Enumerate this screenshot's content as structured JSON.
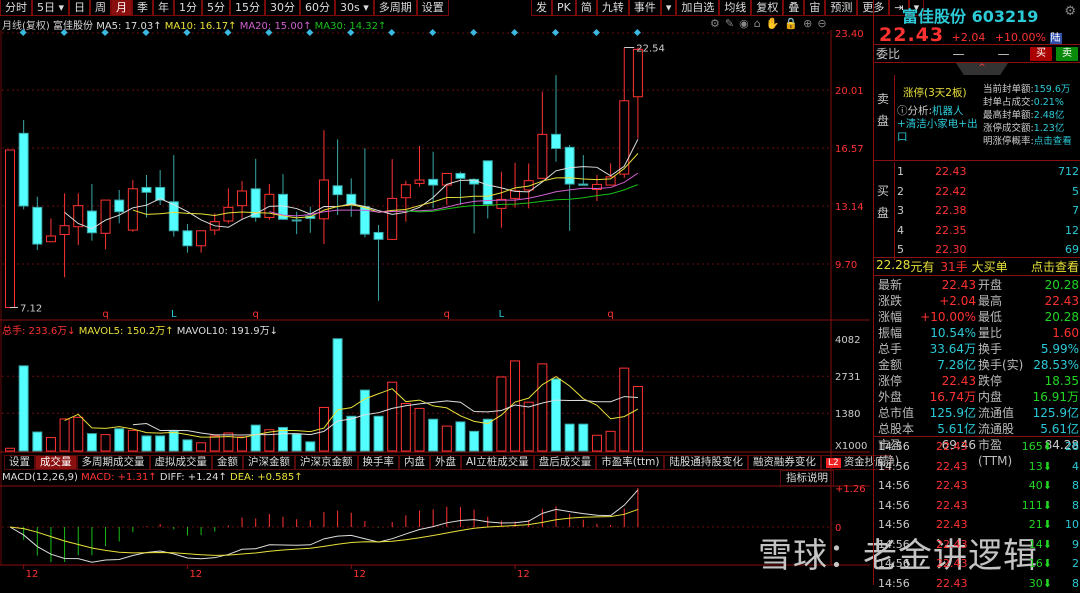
{
  "toolbar": {
    "left": [
      "分时",
      "5日 ▾",
      "日",
      "周",
      "月",
      "季",
      "年",
      "1分",
      "5分",
      "15分",
      "30分",
      "60分",
      "30s ▾",
      "多周期",
      "设置"
    ],
    "active": "月",
    "right": [
      "发",
      "PK",
      "简",
      "九转",
      "事件",
      "▾",
      "加自选",
      "均线",
      "复权",
      "叠",
      "宙",
      "预测",
      "更多",
      "⇥",
      "▾"
    ]
  },
  "info": {
    "period": "月线(复权)",
    "name": "富佳股份",
    "ma5": "MA5: 17.03↑",
    "ma10": "MA10: 16.17↑",
    "ma20": "MA20: 15.00↑",
    "ma30": "MA30: 14.32↑"
  },
  "tools": [
    "⚙",
    "✎",
    "◉",
    "⌂",
    "✋",
    "🔒",
    "⊕",
    "⊖"
  ],
  "price_axis": [
    "23.40",
    "20.01",
    "16.57",
    "13.14",
    "9.70"
  ],
  "price_levels": [
    23.4,
    20.01,
    16.57,
    13.14,
    9.7
  ],
  "high_label": "22.54",
  "low_label": "7.12",
  "markers": [
    {
      "i": 7,
      "t": "q",
      "c": "#ff3232"
    },
    {
      "i": 12,
      "t": "L",
      "c": "#2cc9d6"
    },
    {
      "i": 18,
      "t": "q",
      "c": "#ff3232"
    },
    {
      "i": 32,
      "t": "q",
      "c": "#ff3232"
    },
    {
      "i": 36,
      "t": "L",
      "c": "#2cc9d6"
    },
    {
      "i": 44,
      "t": "q",
      "c": "#ff3232"
    }
  ],
  "candles": [
    [
      7.12,
      16.46,
      16.46,
      7.12
    ],
    [
      17.45,
      13.14,
      18.24,
      12.94
    ],
    [
      13.06,
      10.88,
      13.69,
      10.53
    ],
    [
      11.02,
      11.36,
      12.4,
      11.02
    ],
    [
      11.45,
      11.97,
      13.89,
      8.91
    ],
    [
      11.91,
      13.16,
      13.89,
      10.82
    ],
    [
      12.84,
      11.55,
      14.44,
      11.08
    ],
    [
      11.52,
      13.49,
      13.49,
      10.57
    ],
    [
      13.49,
      12.8,
      14.09,
      12.11
    ],
    [
      11.71,
      14.16,
      14.68,
      11.61
    ],
    [
      14.24,
      13.95,
      14.98,
      12.46
    ],
    [
      14.24,
      13.49,
      15.27,
      13.2
    ],
    [
      13.39,
      11.67,
      16.16,
      11.32
    ],
    [
      11.67,
      10.78,
      12.07,
      10.37
    ],
    [
      10.78,
      11.67,
      11.67,
      10.37
    ],
    [
      11.71,
      12.21,
      12.7,
      11.42
    ],
    [
      12.25,
      13.06,
      14.18,
      12.11
    ],
    [
      13.16,
      14.03,
      14.62,
      12.4
    ],
    [
      14.16,
      12.46,
      15.94,
      12.21
    ],
    [
      12.46,
      13.83,
      14.44,
      12.31
    ],
    [
      13.83,
      12.35,
      15.03,
      12.31
    ],
    [
      12.31,
      12.27,
      12.8,
      11.47
    ],
    [
      12.54,
      12.4,
      13.1,
      11.55
    ],
    [
      12.38,
      14.68,
      17.64,
      10.88
    ],
    [
      14.34,
      13.81,
      17.09,
      12.6
    ],
    [
      13.83,
      13.2,
      14.78,
      12.5
    ],
    [
      13.1,
      11.47,
      16.56,
      11.28
    ],
    [
      11.57,
      11.16,
      12.01,
      7.52
    ],
    [
      11.16,
      13.59,
      15.92,
      11.12
    ],
    [
      13.63,
      14.4,
      14.64,
      12.21
    ],
    [
      14.48,
      14.68,
      16.7,
      14.28
    ],
    [
      14.72,
      14.38,
      16.36,
      13.0
    ],
    [
      14.38,
      15.07,
      15.07,
      13.2
    ],
    [
      15.07,
      14.78,
      15.17,
      13.2
    ],
    [
      14.72,
      14.44,
      14.78,
      11.51
    ],
    [
      15.82,
      13.24,
      15.82,
      12.4
    ],
    [
      13.0,
      13.53,
      15.17,
      11.85
    ],
    [
      13.59,
      14.03,
      15.7,
      13.04
    ],
    [
      14.09,
      14.64,
      15.66,
      13.0
    ],
    [
      14.78,
      17.39,
      19.92,
      14.78
    ],
    [
      17.39,
      16.55,
      20.9,
      15.76
    ],
    [
      16.62,
      14.44,
      16.76,
      11.67
    ],
    [
      14.44,
      14.37,
      16.16,
      14.37
    ],
    [
      14.12,
      14.42,
      14.97,
      13.43
    ],
    [
      14.38,
      14.87,
      15.67,
      14.38
    ],
    [
      15.03,
      19.38,
      22.54,
      14.81
    ],
    [
      19.62,
      22.43,
      22.54,
      17.15
    ]
  ],
  "volume": {
    "header": {
      "total": "总手: 233.6万↓",
      "mavol5": "MAVOL5: 150.2万↑",
      "mavol10": "MAVOL10: 191.9万↓"
    },
    "axis": [
      "4082",
      "2731",
      "1380",
      "X1000"
    ],
    "levels": [
      4082,
      2731,
      1380
    ],
    "values": [
      100,
      3110,
      694,
      490,
      1170,
      1230,
      634,
      598,
      813,
      753,
      550,
      550,
      730,
      407,
      300,
      550,
      658,
      514,
      945,
      777,
      861,
      622,
      335,
      1590,
      4100,
      1268,
      2224,
      1268,
      2512,
      1734,
      1555,
      1160,
      909,
      1064,
      718,
      1160,
      2703,
      3289,
      1782,
      3181,
      2631,
      981,
      981,
      574,
      718,
      3026,
      2356
    ]
  },
  "tabs": [
    "设置",
    "成交量",
    "多周期成交量",
    "虚拟成交量",
    "金额",
    "沪深金额",
    "沪深京金额",
    "换手率",
    "内盘",
    "外盘",
    "AI立桩成交量",
    "盘后成交量",
    "市盈率(ttm)",
    "陆股通持股变化",
    "融资融券变化",
    "资金抄底"
  ],
  "tab_active": "成交量",
  "tab_l2": "L2",
  "explain": "指标说明",
  "macd": {
    "label": "MACD(12,26,9)",
    "macd": "MACD: +1.31↑",
    "diff": "DIFF: +1.24↑",
    "dea": "DEA: +0.585↑",
    "axis_top": "+1.26",
    "axis_zero": "0"
  },
  "date_labels": [
    {
      "i": 1,
      "t": "12"
    },
    {
      "i": 13,
      "t": "12"
    },
    {
      "i": 25,
      "t": "12"
    },
    {
      "i": 37,
      "t": "12"
    }
  ],
  "watermark": "雪球：老金讲逻辑",
  "panel": {
    "title": "富佳股份 603219",
    "price": "22.43",
    "change": "+2.04",
    "pct": "+10.00%",
    "badge": "陆",
    "weibi": "委比",
    "weibi_v1": "—",
    "weibi_v2": "—",
    "buy": "买",
    "sell": "卖",
    "sell_label": "卖盘",
    "buy_label": "买盘",
    "limit": "涨停(3天2板)",
    "analysis_label": "ⓘ分析:",
    "analysis": "机器人+清洁小家电+出口",
    "kv": [
      [
        "当前封单额:",
        "159.6万"
      ],
      [
        "封单占成交:",
        "0.21%"
      ],
      [
        "最高封单额:",
        "2.48亿"
      ],
      [
        "涨停成交额:",
        "1.23亿"
      ],
      [
        "明涨停概率:",
        "点击查看"
      ]
    ],
    "bids": [
      [
        "1",
        "22.43",
        "712"
      ],
      [
        "2",
        "22.42",
        "5"
      ],
      [
        "3",
        "22.38",
        "7"
      ],
      [
        "4",
        "22.35",
        "12"
      ],
      [
        "5",
        "22.30",
        "69"
      ]
    ],
    "big_order": {
      "price": "22.28",
      "you": "元有",
      "qty": "31手",
      "label": "大买单",
      "link": "点击查看"
    },
    "stats": [
      [
        "最新",
        "22.43",
        "red",
        "开盘",
        "20.28",
        "grn"
      ],
      [
        "涨跌",
        "+2.04",
        "red",
        "最高",
        "22.43",
        "red"
      ],
      [
        "涨幅",
        "+10.00%",
        "red",
        "最低",
        "20.28",
        "grn"
      ],
      [
        "振幅",
        "10.54%",
        "cyn",
        "量比",
        "1.60",
        "red"
      ],
      [
        "总手",
        "33.64万",
        "cyn",
        "换手",
        "5.99%",
        "cyn"
      ],
      [
        "金额",
        "7.28亿",
        "cyn",
        "换手(实)",
        "28.53%",
        "cyn"
      ],
      [
        "涨停",
        "22.43",
        "red",
        "跌停",
        "18.35",
        "grn"
      ],
      [
        "外盘",
        "16.74万",
        "red",
        "内盘",
        "16.91万",
        "grn"
      ],
      [
        "总市值",
        "125.9亿",
        "cyn",
        "流通值",
        "125.9亿",
        "cyn"
      ],
      [
        "总股本",
        "5.61亿",
        "cyn",
        "流通股",
        "5.61亿",
        "cyn"
      ],
      [
        "市盈(静)",
        "69.46",
        "wht",
        "市盈(TTM)",
        "84.28",
        "wht"
      ]
    ],
    "trades": [
      [
        "14:56",
        "22.43",
        "165",
        "28"
      ],
      [
        "14:56",
        "22.43",
        "13",
        "4"
      ],
      [
        "14:56",
        "22.43",
        "40",
        "8"
      ],
      [
        "14:56",
        "22.43",
        "111",
        "8"
      ],
      [
        "14:56",
        "22.43",
        "21",
        "10"
      ],
      [
        "14:56",
        "22.43",
        "14",
        "9"
      ],
      [
        "14:56",
        "22.43",
        "16",
        "2"
      ],
      [
        "14:56",
        "22.43",
        "30",
        "8"
      ]
    ]
  },
  "colors": {
    "up": "#ff3232",
    "down": "#54ffff",
    "ma5": "#dddddd",
    "ma10": "#e8e03a",
    "ma20": "#d060d0",
    "ma30": "#18c018",
    "grid": "#6a0d0d"
  }
}
